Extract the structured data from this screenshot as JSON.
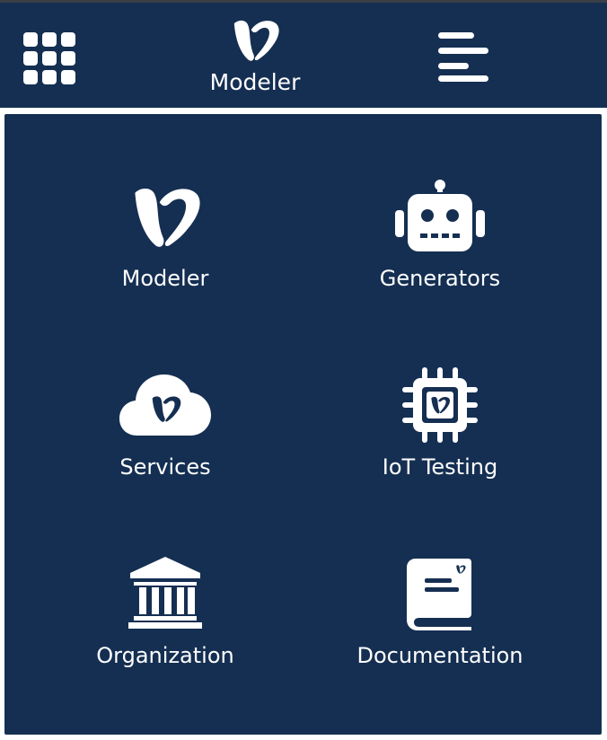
{
  "header": {
    "apps_icon": "grid-icon",
    "brand_icon": "modeler-logo-icon",
    "brand_label": "Modeler",
    "menu_icon": "hamburger-menu-icon"
  },
  "colors": {
    "primary": "#152f52",
    "icon": "#ffffff",
    "background": "#ffffff"
  },
  "tiles": [
    {
      "label": "Modeler",
      "icon": "modeler-logo-icon"
    },
    {
      "label": "Generators",
      "icon": "robot-icon"
    },
    {
      "label": "Services",
      "icon": "cloud-icon"
    },
    {
      "label": "IoT Testing",
      "icon": "chip-icon"
    },
    {
      "label": "Organization",
      "icon": "building-icon"
    },
    {
      "label": "Documentation",
      "icon": "book-icon"
    }
  ]
}
